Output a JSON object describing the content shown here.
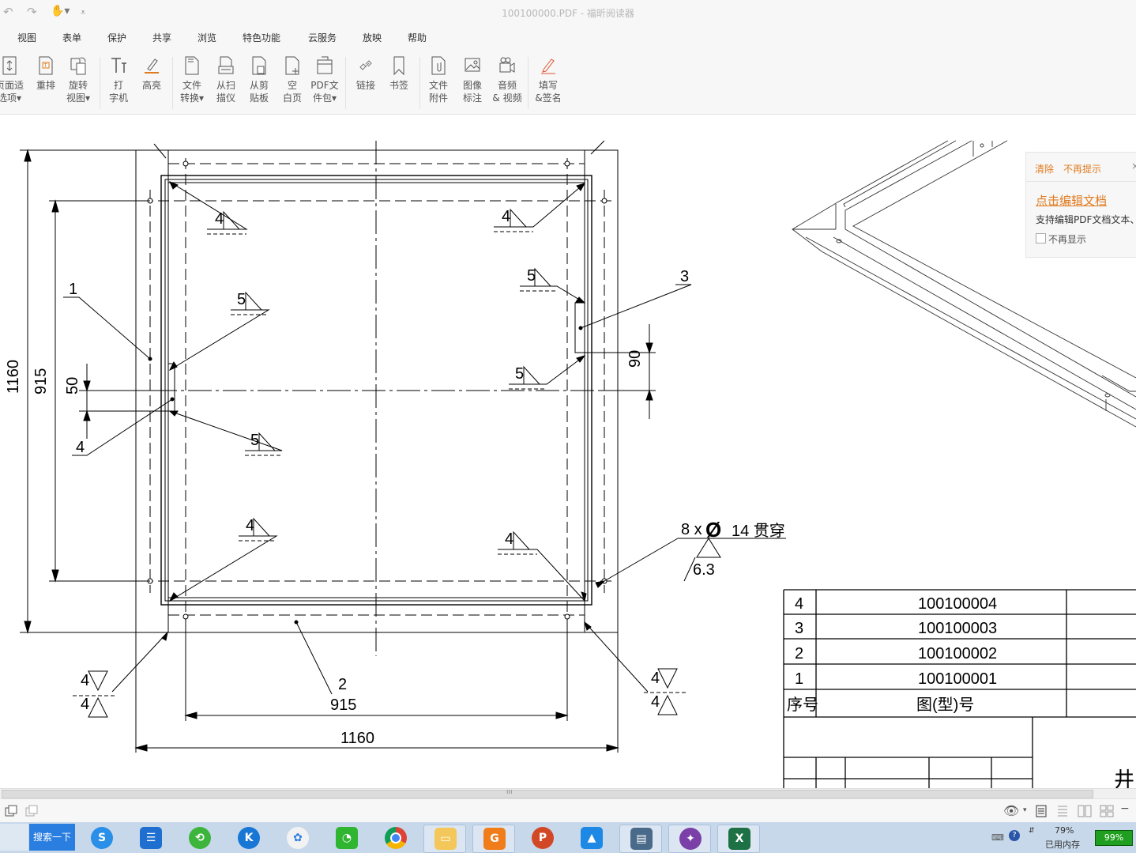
{
  "window": {
    "title": "100100000.PDF - 福昕阅读器"
  },
  "menu": [
    "视图",
    "表单",
    "保护",
    "共享",
    "浏览",
    "特色功能",
    "云服务",
    "放映",
    "帮助"
  ],
  "ribbon": [
    {
      "label": "页面适\n选项▾",
      "icon": "page-fit-icon"
    },
    {
      "label": "重排",
      "icon": "reflow-icon"
    },
    {
      "label": "旋转\n视图▾",
      "icon": "rotate-view-icon"
    },
    {
      "label": "打\n字机",
      "icon": "typewriter-icon"
    },
    {
      "label": "高亮",
      "icon": "highlight-icon"
    },
    {
      "label": "文件\n转换▾",
      "icon": "file-convert-icon"
    },
    {
      "label": "从扫\n描仪",
      "icon": "scanner-icon"
    },
    {
      "label": "从剪\n贴板",
      "icon": "clipboard-icon"
    },
    {
      "label": "空\n白页",
      "icon": "blank-page-icon"
    },
    {
      "label": "PDF文\n件包▾",
      "icon": "pdf-package-icon"
    },
    {
      "label": "链接",
      "icon": "link-icon"
    },
    {
      "label": "书签",
      "icon": "bookmark-icon"
    },
    {
      "label": "文件\n附件",
      "icon": "file-attachment-icon"
    },
    {
      "label": "图像\n标注",
      "icon": "image-annotation-icon"
    },
    {
      "label": "音频\n& 视频",
      "icon": "audio-video-icon"
    },
    {
      "label": "填写\n&签名",
      "icon": "fill-sign-icon"
    }
  ],
  "popup": {
    "clear": "清除",
    "no_remind": "不再提示",
    "headline": "点击编辑文档",
    "desc": "支持编辑PDF文档文本、",
    "checkbox_label": "不再显示"
  },
  "drawing": {
    "dim_1160_vertical": "1160",
    "dim_915_vertical": "915",
    "dim_50": "50",
    "dim_90": "90",
    "dim_915_horizontal": "915",
    "dim_1160_horizontal": "1160",
    "part_1": "1",
    "part_2": "2",
    "part_3": "3",
    "part_4": "4",
    "weld_4": "4",
    "weld_5": "5",
    "hole_note": "8 x",
    "hole_diameter_symbol": "Ø",
    "hole_note_rest": "14 贯穿",
    "roughness": "6.3",
    "corner_char": "井"
  },
  "bom": {
    "rows": [
      {
        "no": "4",
        "code": "100100004"
      },
      {
        "no": "3",
        "code": "100100003"
      },
      {
        "no": "2",
        "code": "100100002"
      },
      {
        "no": "1",
        "code": "100100001"
      }
    ],
    "header_no": "序号",
    "header_code": "图(型)号"
  },
  "statusbar": {},
  "taskbar": {
    "search_button": "搜索一下",
    "memory_percent": "79%",
    "memory_label": "已用内存",
    "battery": "99%"
  }
}
